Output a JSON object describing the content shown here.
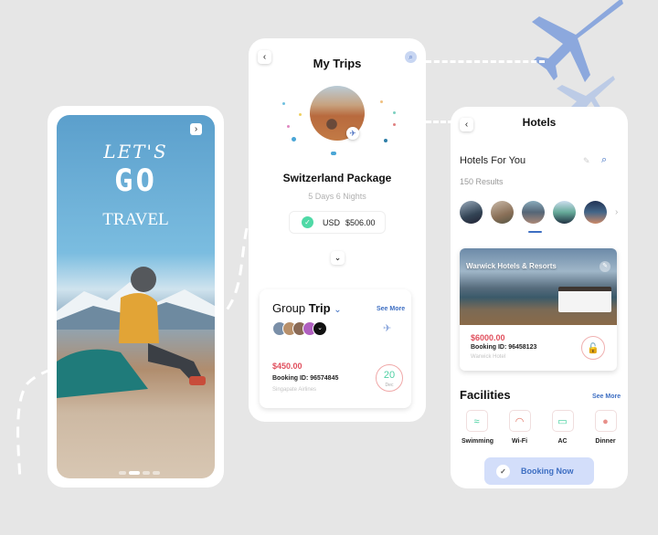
{
  "colors": {
    "background": "#e6e6e6",
    "accent_blue": "#3d6ec2",
    "price_red": "#e04e5c",
    "success_green": "#4fd9a6",
    "plane_blue": "#8ca8dd"
  },
  "splash": {
    "line1": "LET'S",
    "line2": "GO",
    "line3": "TRAVEL",
    "next_icon": "›"
  },
  "trips": {
    "title": "My Trips",
    "back_icon": "‹",
    "search_icon": "⌕",
    "package_title": "Switzerland Package",
    "package_duration": "5 Days 6 Nights",
    "currency": "USD",
    "price": "$506.00",
    "check_icon": "✓",
    "expand_icon": "⌄",
    "plane_icon": "✈",
    "group": {
      "title_prefix": "Group",
      "title_bold": "Trip",
      "dropdown_icon": "⌄",
      "see_more": "See More",
      "price": "$450.00",
      "booking_id": "Booking ID: 96574845",
      "airline": "Singapate Airlines",
      "date_day": "20",
      "date_month": "Dec",
      "more_icon": "⌄",
      "plane_icon": "✈"
    }
  },
  "hotels": {
    "title": "Hotels",
    "back_icon": "‹",
    "section_title": "Hotels For You",
    "results": "150 Results",
    "edit_icon": "✎",
    "search_icon": "⌕",
    "next_icon": "›",
    "featured": {
      "name": "Warwick Hotels & Resorts",
      "price": "$6000.00",
      "booking_id": "Booking ID: 96458123",
      "hotel": "Warwick Hotel",
      "lock_icon": "🔓",
      "edit_icon": "✎"
    },
    "facilities_title": "Facilities",
    "see_more": "See More",
    "facilities": [
      {
        "label": "Swimming",
        "icon": "≈"
      },
      {
        "label": "Wi-Fi",
        "icon": "◠"
      },
      {
        "label": "AC",
        "icon": "▭"
      },
      {
        "label": "Dinner",
        "icon": "●"
      }
    ],
    "booking_button": "Booking Now",
    "booking_check": "✓"
  }
}
